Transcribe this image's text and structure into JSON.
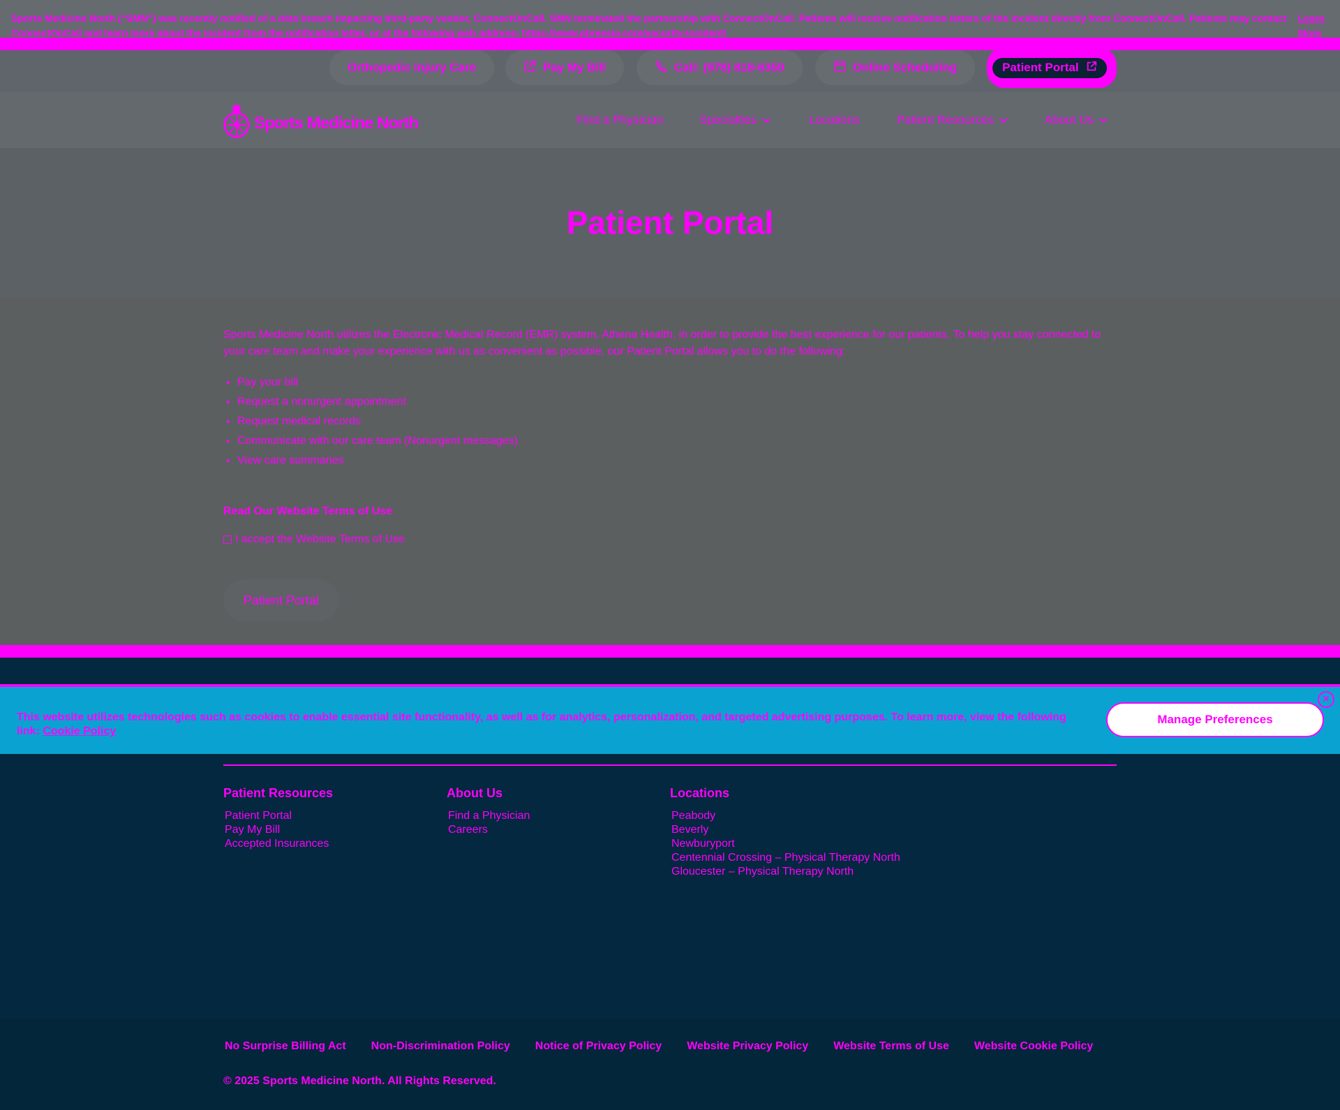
{
  "alert": {
    "message": "Sports Medicine North (“SMN”) was recently notified of a data breach impacting third-party vendor, ConnectOnCall. SMN terminated the partnership with ConnectOnCall. Patients will receive notification letters of the incident directly from ConnectOnCall. Patients may contact ConnectOnCall and learn more about the incident from the notification letter, or at the following web address: https://www.pbreesia.com/security-incident/",
    "learn_more": "Learn More"
  },
  "topbar": {
    "ortho": "Orthopedic Injury Care",
    "pay_bill": "Pay My Bill",
    "call": "Call: (978) 818-6350",
    "scheduling": "Online Scheduling",
    "portal": "Patient Portal"
  },
  "nav": {
    "logo_text": "Sports Medicine North",
    "items": [
      {
        "label": "Find a Physician"
      },
      {
        "label": "Specialties"
      },
      {
        "label": "Locations"
      },
      {
        "label": "Patient Resources"
      },
      {
        "label": "About Us"
      }
    ]
  },
  "hero": {
    "title": "Patient Portal"
  },
  "content": {
    "intro": "Sports Medicine North utilizes the Electronic Medical Record (EMR) system, Athena Health, in order to provide the best experience for our patients. To help you stay connected to your care team and make your experience with us as convenient as possible, our Patient Portal allows you to do the following:",
    "list": [
      "Pay your bill",
      "Request a nonurgent appointment",
      "Request medical records",
      "Communicate with our care team (Nonurgent messages)",
      "View care summaries"
    ],
    "terms_link": "Read Our Website Terms of Use",
    "accept_label": "I accept the Website Terms of Use",
    "portal_button": "Patient Portal"
  },
  "cookie": {
    "text": "This website utilizes technologies such as cookies to enable essential site functionality, as well as for analytics, personalization, and targeted advertising purposes. To learn more, view the following link:",
    "link": "Cookie Policy",
    "manage": "Manage Preferences"
  },
  "footer": {
    "columns": [
      {
        "title": "Patient Resources",
        "items": [
          "Patient Portal",
          "Pay My Bill",
          "Accepted Insurances"
        ]
      },
      {
        "title": "About Us",
        "items": [
          "Find a Physician",
          "Careers"
        ]
      },
      {
        "title": "Locations",
        "items": [
          "Peabody",
          "Beverly",
          "Newburyport",
          "Centennial Crossing – Physical Therapy North",
          "Gloucester – Physical Therapy North"
        ]
      }
    ],
    "legal": [
      "No Surprise Billing Act",
      "Non-Discrimination Policy",
      "Notice of Privacy Policy",
      "Website Privacy Policy",
      "Website Terms of Use",
      "Website Cookie Policy"
    ],
    "copyright": "© 2025 Sports Medicine North. All Rights Reserved."
  },
  "colors": {
    "accent": "#ff00ff",
    "footer_bg": "#03283f",
    "cookie_bg": "#0aa3d1"
  }
}
